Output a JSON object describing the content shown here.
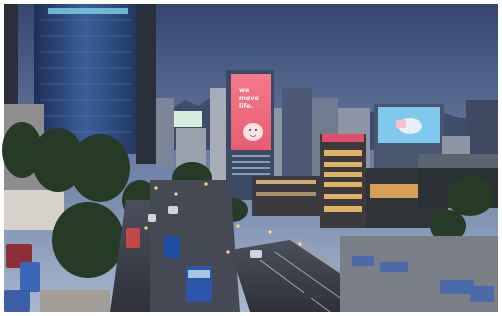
{
  "photo": {
    "billboard_left": {
      "lines": [
        "we",
        "move",
        "life."
      ]
    }
  },
  "colors": {
    "sky_top": "#3a4d78",
    "sky_bottom": "#9fb2cc",
    "billboard_pink": "#f06b7e",
    "highway": "#3b3f4a"
  }
}
